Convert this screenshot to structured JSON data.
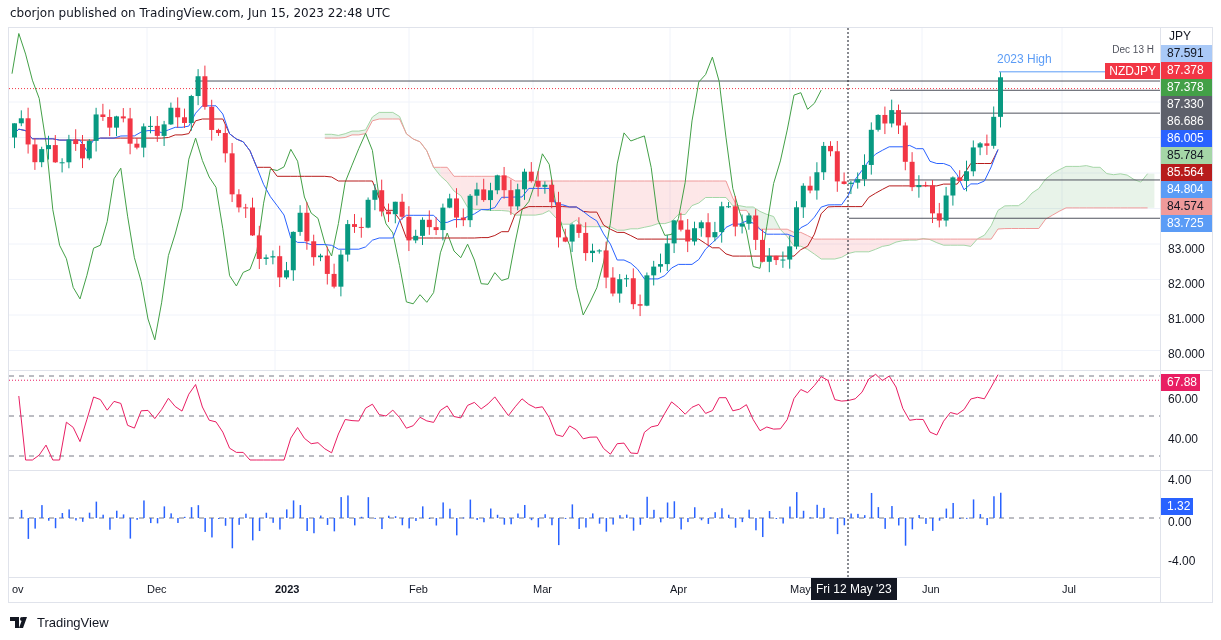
{
  "header": {
    "text": "cborjon published on TradingView.com, Jun 15, 2023 22:48 UTC"
  },
  "main_pane": {
    "currency": "JPY",
    "high_note": "Dec 13 H",
    "annotation": "2023 High",
    "symbol_tag": "NZDJPY",
    "price_labels": [
      {
        "text": "87.591",
        "color": "#a9c9f7"
      },
      {
        "text": "87.378",
        "color": "#f23645"
      },
      {
        "text": "87.378",
        "color": "#43a047"
      },
      {
        "text": "87.330",
        "color": "#5d606b"
      },
      {
        "text": "86.686",
        "color": "#5d606b"
      },
      {
        "text": "86.005",
        "color": "#2962ff"
      },
      {
        "text": "85.784",
        "color": "#a5d6a7"
      },
      {
        "text": "85.564",
        "color": "#b71c1c"
      },
      {
        "text": "84.804",
        "color": "#5b9cf6"
      },
      {
        "text": "84.574",
        "color": "#ef9a9a"
      },
      {
        "text": "83.725",
        "color": "#5b9cf6"
      }
    ],
    "ticks": [
      "83.000",
      "82.000",
      "81.000",
      "80.000"
    ]
  },
  "rsi_pane": {
    "value_label": "67.88",
    "ticks": [
      "60.00",
      "40.00"
    ]
  },
  "histogram_pane": {
    "ticks": [
      "4.00",
      "0.00",
      "-4.00"
    ],
    "value_label": "1.32"
  },
  "time_axis": {
    "labels": [
      {
        "text": "ov",
        "kind": "month"
      },
      {
        "text": "Dec",
        "kind": "month"
      },
      {
        "text": "2023",
        "kind": "year"
      },
      {
        "text": "Feb",
        "kind": "month"
      },
      {
        "text": "Mar",
        "kind": "month"
      },
      {
        "text": "Apr",
        "kind": "month"
      },
      {
        "text": "May",
        "kind": "month"
      },
      {
        "text": "Jun",
        "kind": "month"
      },
      {
        "text": "Jul",
        "kind": "month"
      }
    ],
    "crosshair_label": "Fri 12 May '23"
  },
  "footer": {
    "logo_text": "TradingView"
  }
}
